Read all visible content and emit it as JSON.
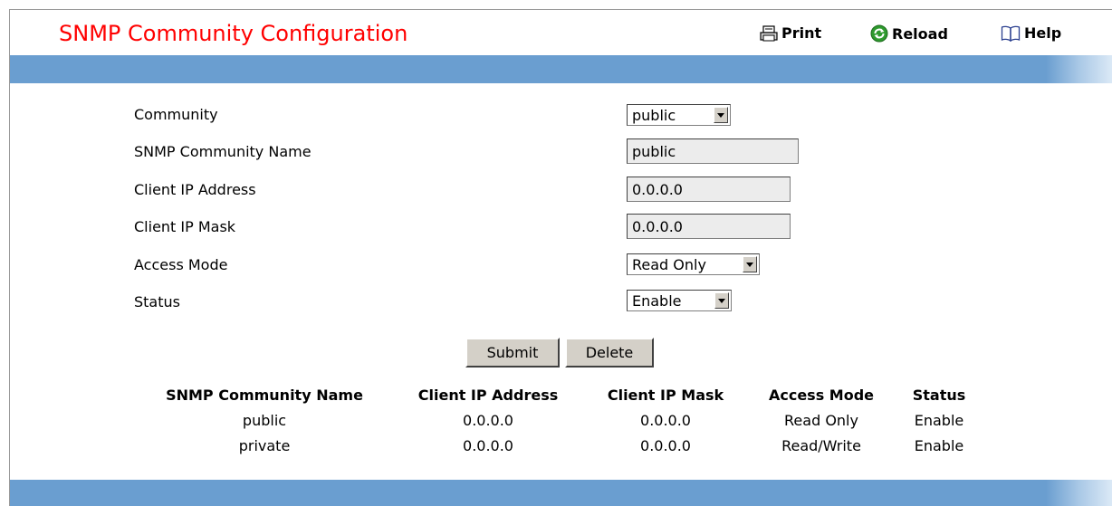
{
  "header": {
    "title": "SNMP Community Configuration",
    "print_label": "Print",
    "reload_label": "Reload",
    "help_label": "Help"
  },
  "form": {
    "community_label": "Community",
    "community_value": "public",
    "name_label": "SNMP Community Name",
    "name_value": "public",
    "ip_label": "Client IP Address",
    "ip_value": "0.0.0.0",
    "mask_label": "Client IP Mask",
    "mask_value": "0.0.0.0",
    "access_label": "Access Mode",
    "access_value": "Read Only",
    "status_label": "Status",
    "status_value": "Enable"
  },
  "buttons": {
    "submit": "Submit",
    "delete": "Delete"
  },
  "table": {
    "headers": [
      "SNMP Community Name",
      "Client IP Address",
      "Client IP Mask",
      "Access Mode",
      "Status"
    ],
    "rows": [
      [
        "public",
        "0.0.0.0",
        "0.0.0.0",
        "Read Only",
        "Enable"
      ],
      [
        "private",
        "0.0.0.0",
        "0.0.0.0",
        "Read/Write",
        "Enable"
      ]
    ]
  },
  "colors": {
    "title": "#ff0000",
    "bar": "#6a9ed0",
    "button_face": "#d4d0c8"
  }
}
